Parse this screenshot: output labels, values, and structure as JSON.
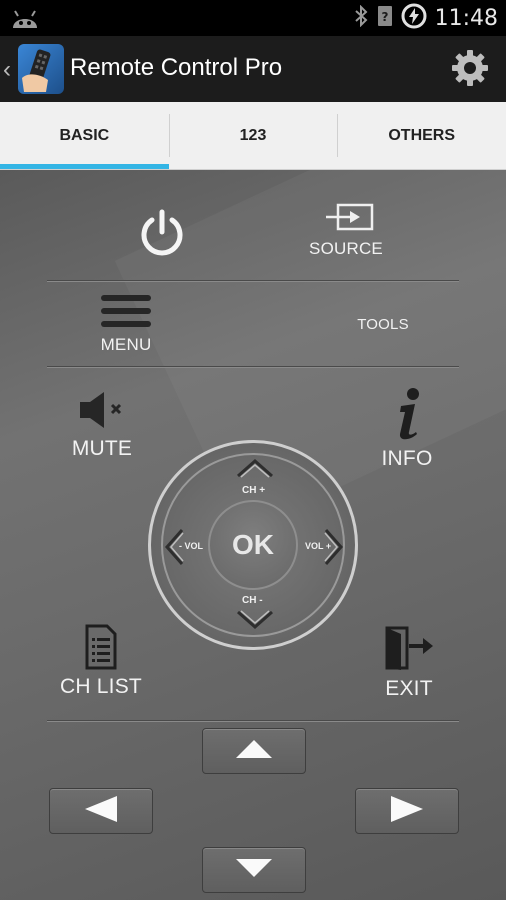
{
  "status_bar": {
    "time": "11:48"
  },
  "action_bar": {
    "title": "Remote Control Pro"
  },
  "tabs": [
    {
      "label": "BASIC",
      "active": true
    },
    {
      "label": "123",
      "active": false
    },
    {
      "label": "OTHERS",
      "active": false
    }
  ],
  "remote": {
    "source_label": "SOURCE",
    "menu_label": "MENU",
    "tools_label": "TOOLS",
    "mute_label": "MUTE",
    "info_label": "INFO",
    "ch_list_label": "CH LIST",
    "exit_label": "EXIT",
    "dpad": {
      "ok_label": "OK",
      "ch_up_label": "CH +",
      "ch_down_label": "CH -",
      "vol_down_label": "- VOL",
      "vol_up_label": "VOL +"
    }
  },
  "colors": {
    "tab_indicator": "#33b5e5",
    "action_bar": "#1c1c1c",
    "remote_background": "#666666"
  }
}
